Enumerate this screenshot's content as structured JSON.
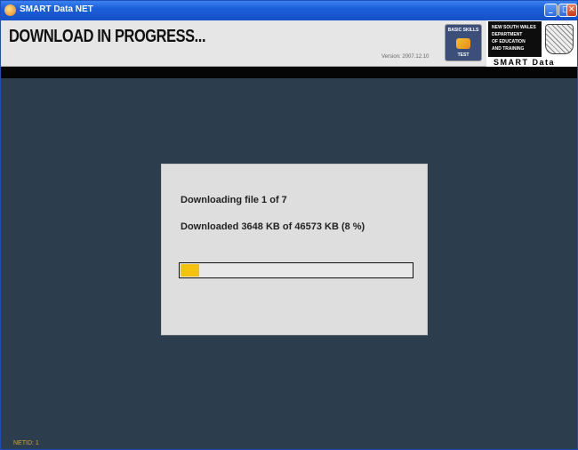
{
  "window": {
    "title": "SMART Data NET",
    "buttons": {
      "minimize": "_",
      "maximize": "□",
      "close": "✕"
    }
  },
  "header": {
    "heading": "DOWNLOAD IN PROGRESS...",
    "version": "Version: 2007.12.10",
    "logo_bst": {
      "top": "BASIC SKILLS",
      "bottom": "TEST"
    },
    "logo_dept": {
      "lines": [
        "NEW SOUTH WALES",
        "DEPARTMENT",
        "OF EDUCATION",
        "AND TRAINING"
      ],
      "caption": "SMART Data"
    }
  },
  "dialog": {
    "file_status": "Downloading file 1 of 7",
    "bytes_status": "Downloaded 3648 KB of 46573 KB (8 %)",
    "progress_fraction": 0.08
  },
  "footer": {
    "netid": "NETID: 1"
  },
  "colors": {
    "background": "#2c3e4e",
    "progress_fill": "#f3c10e",
    "titlebar": "#1a5fd8"
  }
}
